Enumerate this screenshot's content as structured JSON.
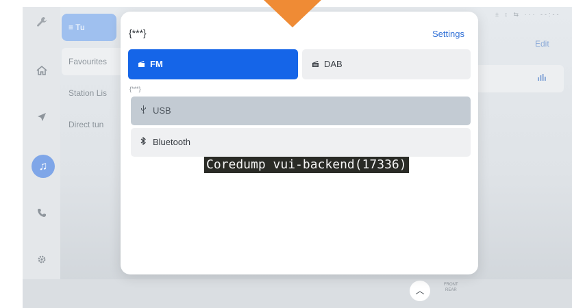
{
  "background": {
    "tab_label": "≡ Tu",
    "list_items": [
      "Favourites",
      "Station Lis",
      "Direct tun"
    ],
    "edit_label": "Edit",
    "bars_icon": "equalizer-icon",
    "status_text": "± ↕ ⇆ ··· --:--",
    "front_label": "FRONT",
    "rear_label": "REAR"
  },
  "sidebar_icons": [
    "wrench-icon",
    "home-icon",
    "navigation-icon",
    "music-icon",
    "phone-icon",
    "gear-icon"
  ],
  "dialog": {
    "title": "{***}",
    "settings_label": "Settings",
    "subtitle": "{***}",
    "sources": {
      "fm": "FM",
      "dab": "DAB",
      "usb": "USB",
      "bluetooth": "Bluetooth"
    }
  },
  "error_overlay": "Coredump vui-backend(17336)",
  "colors": {
    "accent": "#1565e8",
    "arrow": "#ef8b35",
    "overlay_bg": "#2a2b26"
  }
}
